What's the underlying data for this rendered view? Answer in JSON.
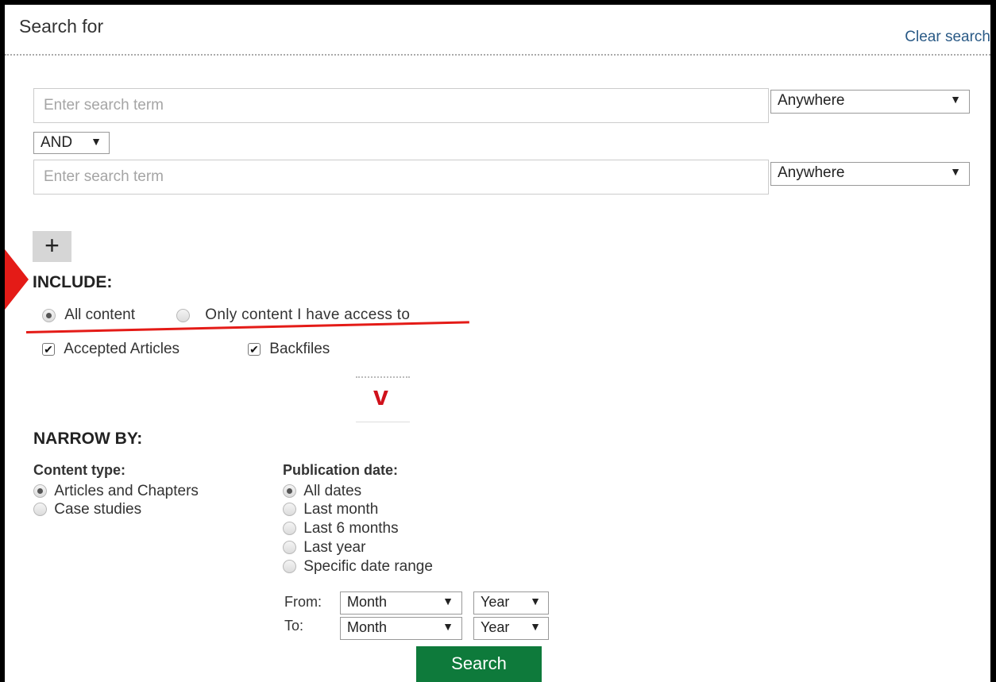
{
  "header": {
    "title": "Search for",
    "clear_link": "Clear search"
  },
  "search_rows": [
    {
      "placeholder": "Enter search term",
      "scope": "Anywhere"
    },
    {
      "placeholder": "Enter search term",
      "scope": "Anywhere"
    }
  ],
  "operator": "AND",
  "include": {
    "heading": "INCLUDE:",
    "options": [
      "All content",
      "Only content I have access to"
    ],
    "selected": "All content",
    "checkboxes": [
      {
        "label": "Accepted Articles",
        "checked": true
      },
      {
        "label": "Backfiles",
        "checked": true
      }
    ]
  },
  "narrow": {
    "heading": "NARROW BY:",
    "content_type_label": "Content type:",
    "content_types": [
      "Articles and Chapters",
      "Case studies"
    ],
    "content_type_selected": "Articles and Chapters",
    "pub_date_label": "Publication date:",
    "pub_dates": [
      "All dates",
      "Last month",
      "Last 6 months",
      "Last year",
      "Specific date range"
    ],
    "pub_date_selected": "All dates",
    "from_label": "From:",
    "to_label": "To:",
    "month_placeholder": "Month",
    "year_placeholder": "Year"
  },
  "search_button": "Search",
  "icons": {
    "dropdown": "▼",
    "plus": "+",
    "chevron": "v",
    "check": "✔"
  },
  "colors": {
    "accent_red": "#e41b17",
    "button_green": "#0e7a3b",
    "link_blue": "#2a5a86"
  }
}
